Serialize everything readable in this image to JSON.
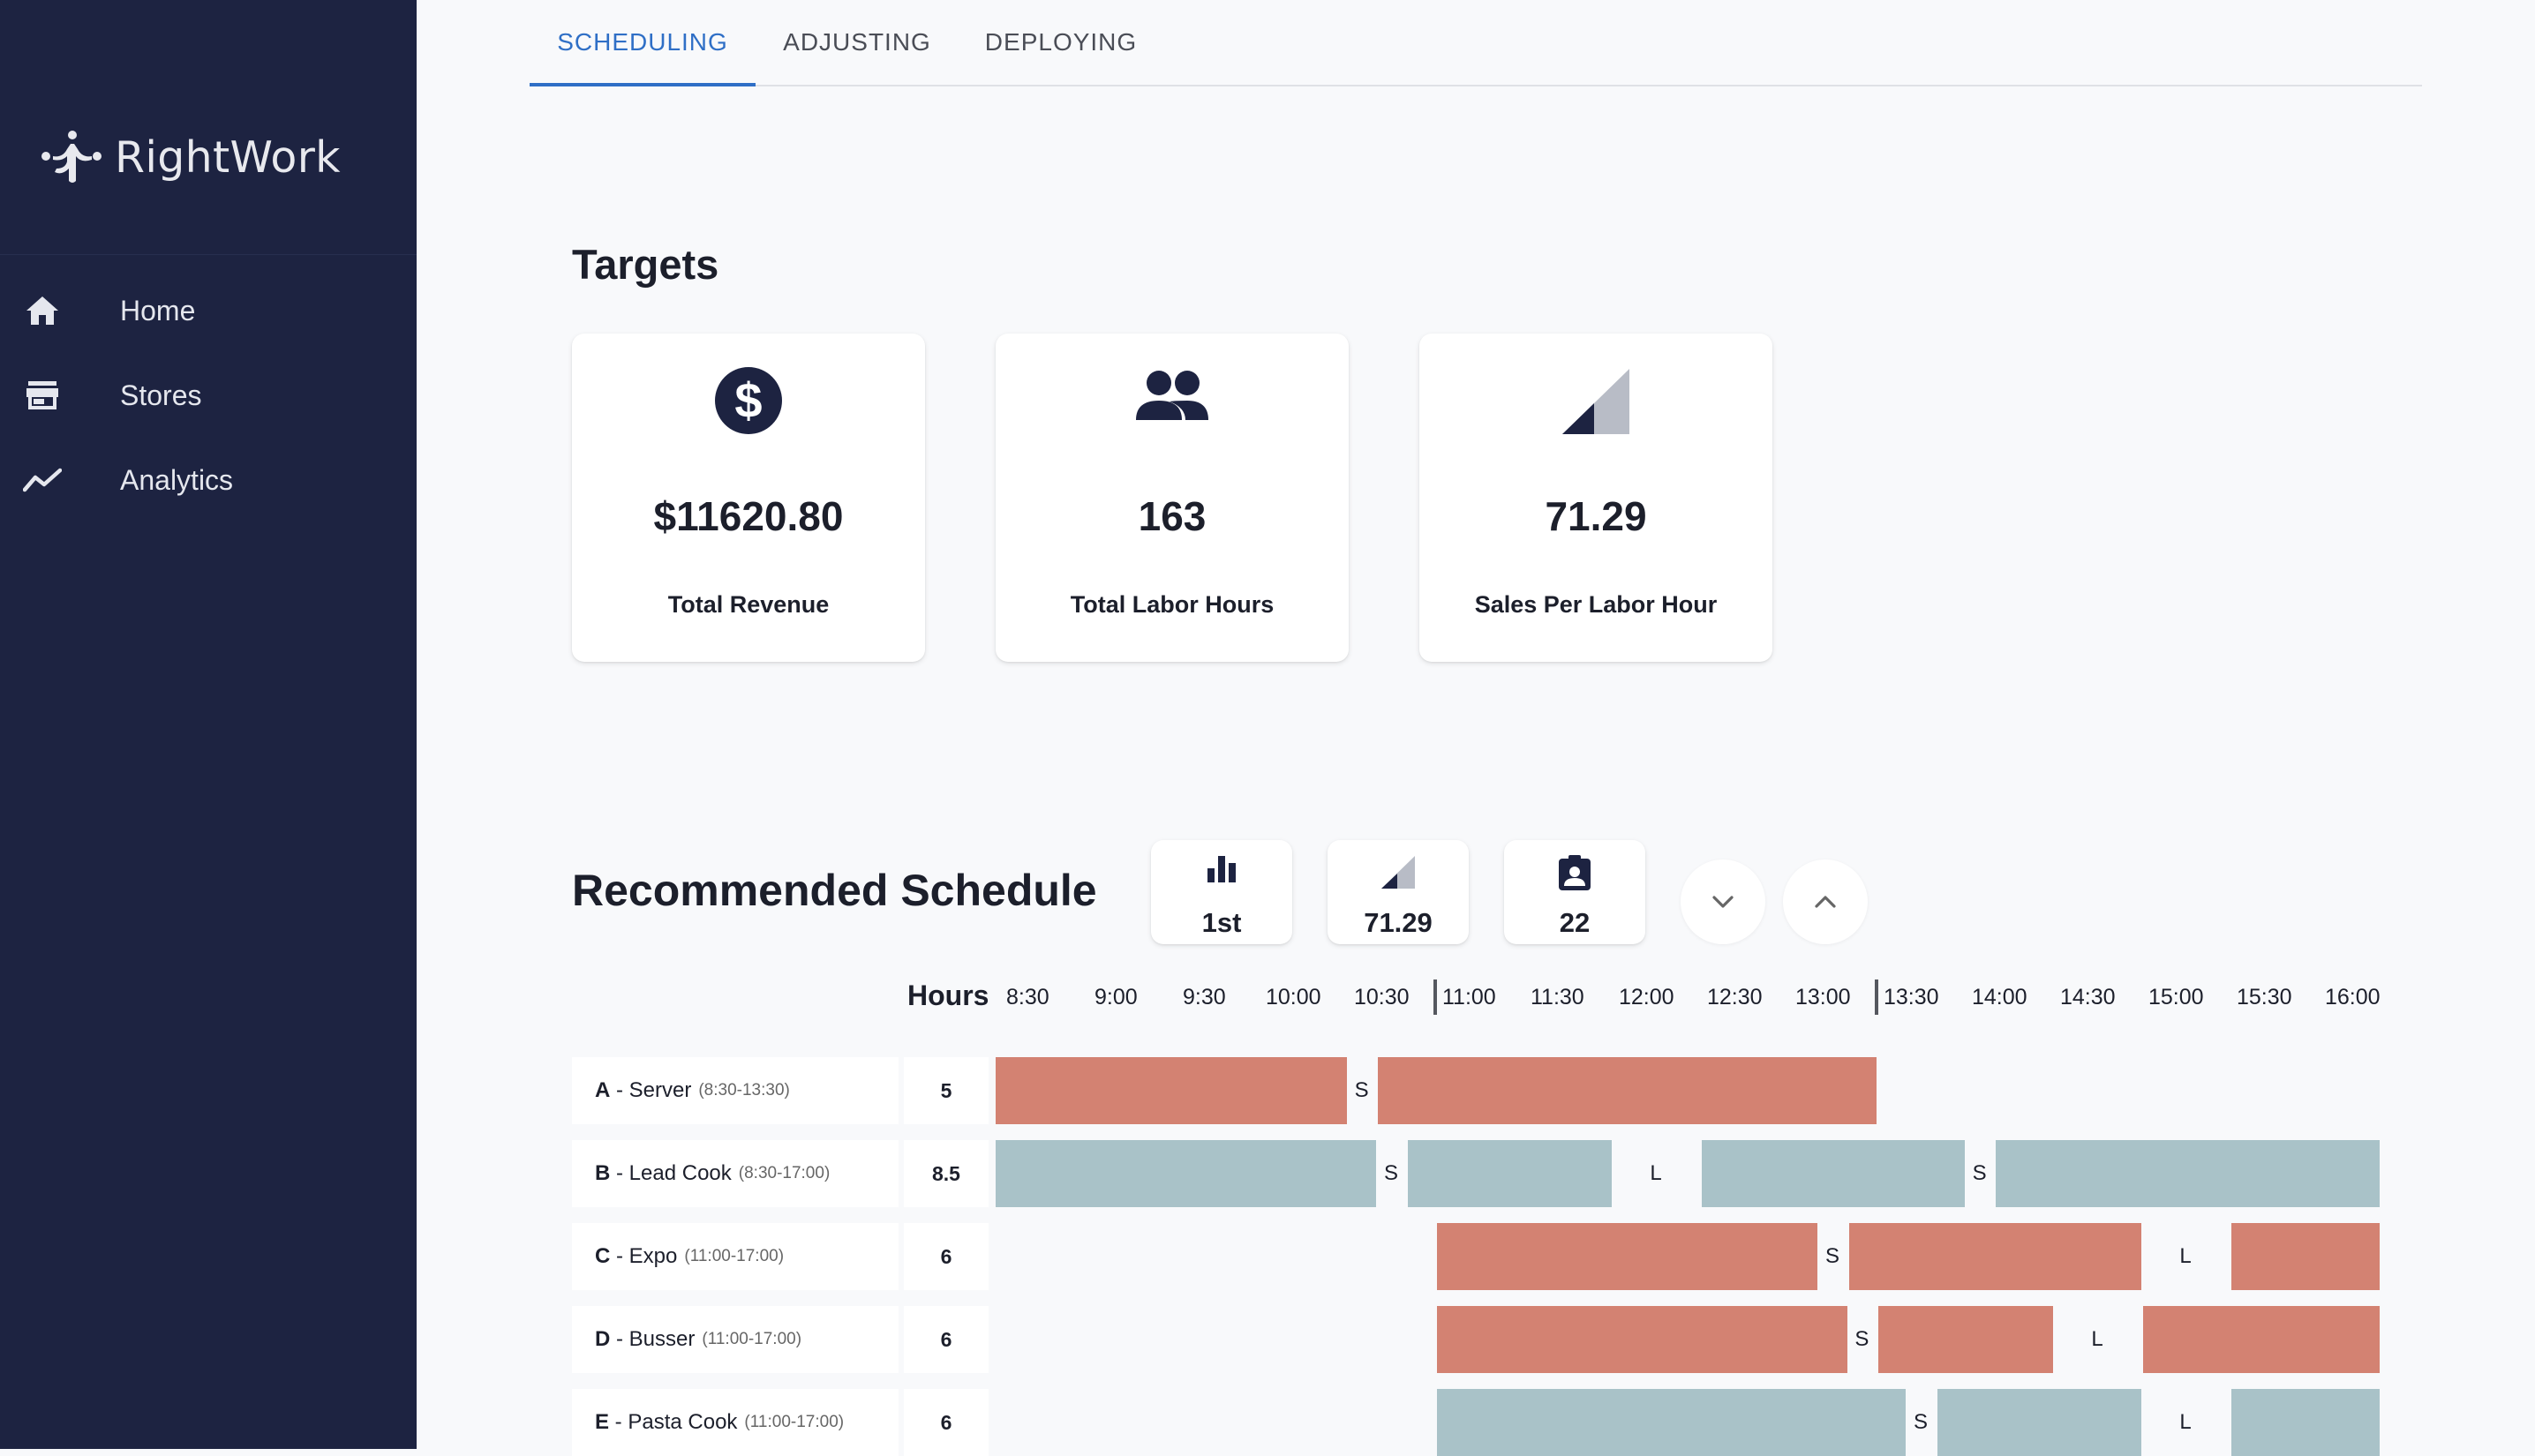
{
  "app": {
    "brand_name": "RightWork"
  },
  "sidebar": {
    "items": [
      {
        "label": "Home",
        "icon": "home-icon"
      },
      {
        "label": "Stores",
        "icon": "store-icon"
      },
      {
        "label": "Analytics",
        "icon": "analytics-icon"
      }
    ]
  },
  "tabs": [
    {
      "label": "SCHEDULING",
      "active": true
    },
    {
      "label": "ADJUSTING",
      "active": false
    },
    {
      "label": "DEPLOYING",
      "active": false
    }
  ],
  "targets": {
    "title": "Targets",
    "cards": [
      {
        "icon": "dollar-icon",
        "value": "$11620.80",
        "label": "Total Revenue"
      },
      {
        "icon": "people-icon",
        "value": "163",
        "label": "Total Labor Hours"
      },
      {
        "icon": "signal-icon",
        "value": "71.29",
        "label": "Sales Per Labor Hour"
      }
    ]
  },
  "schedule": {
    "title": "Recommended Schedule",
    "stats": [
      {
        "icon": "bar-chart-icon",
        "value": "1st"
      },
      {
        "icon": "signal-icon",
        "value": "71.29"
      },
      {
        "icon": "clipboard-user-icon",
        "value": "22"
      }
    ],
    "buttons": [
      {
        "icon": "chevron-down-icon"
      },
      {
        "icon": "chevron-up-icon"
      }
    ],
    "hours_title": "Hours",
    "hours": [
      "8:30",
      "9:00",
      "9:30",
      "10:00",
      "10:30",
      "11:00",
      "11:30",
      "12:00",
      "12:30",
      "13:00",
      "13:30",
      "14:00",
      "14:30",
      "15:00",
      "15:30",
      "16:00"
    ],
    "timeline_start": "8:30",
    "timeline_end": "17:00",
    "colors": {
      "red": "#d38272",
      "blue": "#a9c2c8",
      "nav_bg": "#1d2341",
      "accent": "#2f6fc6"
    },
    "employees": [
      {
        "id": "A",
        "role": "Server",
        "shift": "(8:30-13:30)",
        "hours": "5",
        "color": "red",
        "blocks": [
          {
            "type": "work",
            "start": "8:30",
            "end": "10:30"
          },
          {
            "type": "break",
            "label": "S",
            "start": "10:30",
            "end": "10:40"
          },
          {
            "type": "work",
            "start": "10:40",
            "end": "13:30"
          }
        ]
      },
      {
        "id": "B",
        "role": "Lead Cook",
        "shift": "(8:30-17:00)",
        "hours": "8.5",
        "color": "blue",
        "blocks": [
          {
            "type": "work",
            "start": "8:30",
            "end": "10:40"
          },
          {
            "type": "break",
            "label": "S",
            "start": "10:40",
            "end": "10:50"
          },
          {
            "type": "work",
            "start": "10:50",
            "end": "12:00"
          },
          {
            "type": "break",
            "label": "L",
            "start": "12:00",
            "end": "12:30"
          },
          {
            "type": "work",
            "start": "12:30",
            "end": "14:00"
          },
          {
            "type": "break",
            "label": "S",
            "start": "14:00",
            "end": "14:10"
          },
          {
            "type": "work",
            "start": "14:10",
            "end": "17:00"
          }
        ]
      },
      {
        "id": "C",
        "role": "Expo",
        "shift": "(11:00-17:00)",
        "hours": "6",
        "color": "red",
        "blocks": [
          {
            "type": "work",
            "start": "11:00",
            "end": "13:10"
          },
          {
            "type": "break",
            "label": "S",
            "start": "13:10",
            "end": "13:20"
          },
          {
            "type": "work",
            "start": "13:20",
            "end": "15:00"
          },
          {
            "type": "break",
            "label": "L",
            "start": "15:00",
            "end": "15:30"
          },
          {
            "type": "work",
            "start": "15:30",
            "end": "17:00"
          }
        ]
      },
      {
        "id": "D",
        "role": "Busser",
        "shift": "(11:00-17:00)",
        "hours": "6",
        "color": "red",
        "blocks": [
          {
            "type": "work",
            "start": "11:00",
            "end": "13:20"
          },
          {
            "type": "break",
            "label": "S",
            "start": "13:20",
            "end": "13:30"
          },
          {
            "type": "work",
            "start": "13:30",
            "end": "14:30"
          },
          {
            "type": "break",
            "label": "L",
            "start": "14:30",
            "end": "15:00"
          },
          {
            "type": "work",
            "start": "15:00",
            "end": "17:00"
          }
        ]
      },
      {
        "id": "E",
        "role": "Pasta Cook",
        "shift": "(11:00-17:00)",
        "hours": "6",
        "color": "blue",
        "blocks": [
          {
            "type": "work",
            "start": "11:00",
            "end": "13:40"
          },
          {
            "type": "break",
            "label": "S",
            "start": "13:40",
            "end": "13:50"
          },
          {
            "type": "work",
            "start": "13:50",
            "end": "15:00"
          },
          {
            "type": "break",
            "label": "L",
            "start": "15:00",
            "end": "15:30"
          },
          {
            "type": "work",
            "start": "15:30",
            "end": "17:00"
          }
        ]
      }
    ]
  }
}
